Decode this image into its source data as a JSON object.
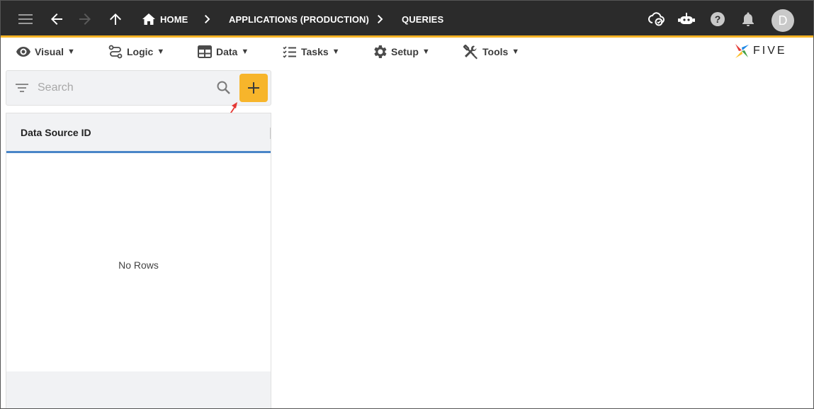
{
  "appbar": {
    "icons": [
      "menu-icon",
      "arrow-back-icon",
      "arrow-forward-icon",
      "arrow-up-icon",
      "home-icon",
      "cloud-check-icon",
      "chatbot-icon",
      "help-icon",
      "bell-icon"
    ],
    "breadcrumb": {
      "home": "HOME",
      "app": "APPLICATIONS (PRODUCTION)",
      "current": "QUERIES"
    },
    "avatar_initial": "D",
    "colors": {
      "bar": "#2b2b2b",
      "accent": "#f5b325"
    }
  },
  "menubar": {
    "items": [
      {
        "label": "Visual",
        "icon": "eye-icon"
      },
      {
        "label": "Logic",
        "icon": "logic-icon"
      },
      {
        "label": "Data",
        "icon": "table-icon"
      },
      {
        "label": "Tasks",
        "icon": "checklist-icon"
      },
      {
        "label": "Setup",
        "icon": "gear-icon"
      },
      {
        "label": "Tools",
        "icon": "tools-icon"
      }
    ],
    "caret": "▼",
    "logo_text": "FIVE"
  },
  "search": {
    "placeholder": "Search",
    "add_button_color": "#f7b52b"
  },
  "list": {
    "column_header": "Data Source ID",
    "empty_text": "No Rows",
    "header_underline_color": "#4a86c8"
  }
}
